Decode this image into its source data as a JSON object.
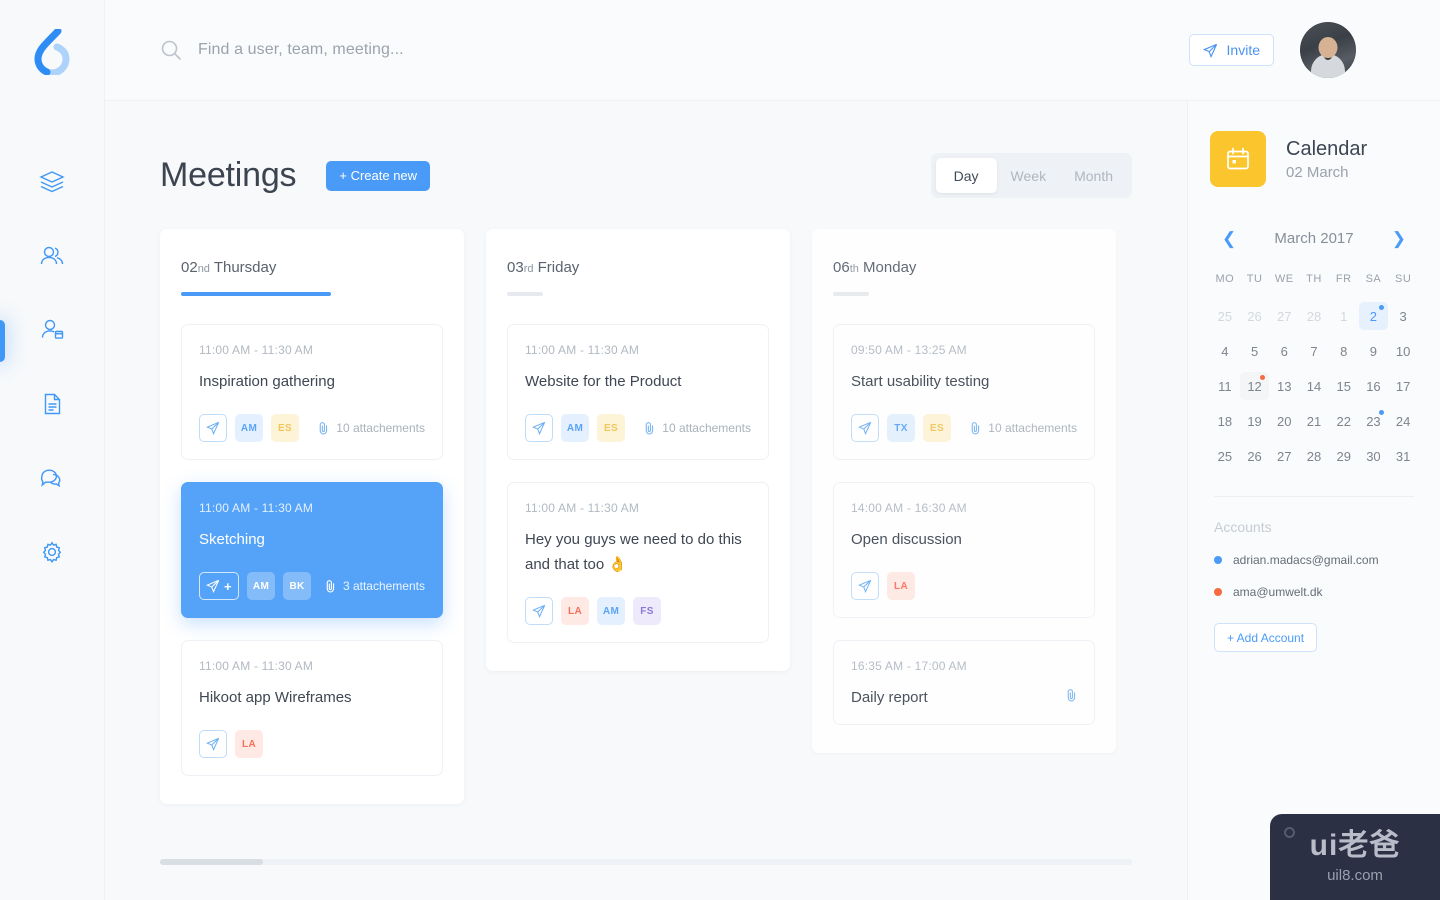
{
  "app": {
    "logo_icon": "droplet-logo"
  },
  "sidebar": {
    "items": [
      {
        "name": "layers",
        "icon": "layers-icon"
      },
      {
        "name": "teams",
        "icon": "users-icon"
      },
      {
        "name": "meetings",
        "icon": "user-calendar-icon",
        "active": true
      },
      {
        "name": "documents",
        "icon": "document-icon"
      },
      {
        "name": "messages",
        "icon": "chat-icon"
      },
      {
        "name": "settings",
        "icon": "gear-icon"
      }
    ]
  },
  "header": {
    "search": {
      "placeholder": "Find a user, team, meeting...",
      "value": "",
      "icon": "search-icon"
    },
    "invite": {
      "label": "Invite",
      "icon": "send-icon"
    },
    "avatar": "user-avatar"
  },
  "main": {
    "title": "Meetings",
    "create_button": "+ Create new",
    "views": [
      {
        "label": "Day",
        "active": true
      },
      {
        "label": "Week",
        "active": false
      },
      {
        "label": "Month",
        "active": false
      }
    ],
    "columns": [
      {
        "day_number": "02",
        "day_suffix": "nd",
        "day_name": "Thursday",
        "progress": "blue",
        "cards": [
          {
            "time": "11:00 AM - 11:30 AM",
            "title": "Inspiration gathering",
            "avatars": [
              {
                "initials": "AM",
                "color": "blue"
              },
              {
                "initials": "ES",
                "color": "yellow"
              }
            ],
            "attachments": "10 attachements",
            "active": false
          },
          {
            "time": "11:00 AM - 11:30 AM",
            "title": "Sketching",
            "avatars": [
              {
                "initials": "AM",
                "color": "white"
              },
              {
                "initials": "BK",
                "color": "white"
              }
            ],
            "attachments": "3 attachements",
            "active": true
          },
          {
            "time": "11:00 AM - 11:30 AM",
            "title": "Hikoot app Wireframes",
            "avatars": [
              {
                "initials": "LA",
                "color": "red"
              }
            ],
            "attachments": "",
            "active": false
          }
        ]
      },
      {
        "day_number": "03",
        "day_suffix": "rd",
        "day_name": "Friday",
        "progress": "grey",
        "cards": [
          {
            "time": "11:00 AM - 11:30 AM",
            "title": "Website for the Product",
            "avatars": [
              {
                "initials": "AM",
                "color": "blue"
              },
              {
                "initials": "ES",
                "color": "yellow"
              }
            ],
            "attachments": "10 attachements",
            "active": false
          },
          {
            "time": "11:00 AM - 11:30 AM",
            "title": "Hey you guys we need to do this and that too 👌",
            "avatars": [
              {
                "initials": "LA",
                "color": "red"
              },
              {
                "initials": "AM",
                "color": "blue"
              },
              {
                "initials": "FS",
                "color": "purple"
              }
            ],
            "attachments": "",
            "active": false
          }
        ]
      },
      {
        "day_number": "06",
        "day_suffix": "th",
        "day_name": "Monday",
        "progress": "grey",
        "cards": [
          {
            "time": "09:50 AM - 13:25 AM",
            "title": "Start usability testing",
            "avatars": [
              {
                "initials": "TX",
                "color": "blue"
              },
              {
                "initials": "ES",
                "color": "yellow"
              }
            ],
            "attachments": "10 attachements",
            "active": false
          },
          {
            "time": "14:00 AM - 16:30 AM",
            "title": "Open discussion",
            "avatars": [
              {
                "initials": "LA",
                "color": "red"
              }
            ],
            "attachments": "",
            "active": false
          },
          {
            "time": "16:35 AM - 17:00 AM",
            "title": "Daily report",
            "avatars": [],
            "attachments": "",
            "attachment_icon_only": true,
            "active": false
          }
        ]
      }
    ]
  },
  "calendar": {
    "icon": "calendar-icon",
    "title": "Calendar",
    "subtitle": "02 March",
    "month_label": "March 2017",
    "prev_icon": "chevron-left-icon",
    "next_icon": "chevron-right-icon",
    "weekdays": [
      "MO",
      "TU",
      "WE",
      "TH",
      "FR",
      "SA",
      "SU"
    ],
    "days": [
      {
        "n": "25",
        "muted": true
      },
      {
        "n": "26",
        "muted": true
      },
      {
        "n": "27",
        "muted": true
      },
      {
        "n": "28",
        "muted": true
      },
      {
        "n": "1",
        "muted": true
      },
      {
        "n": "2",
        "selected": true,
        "dot": "blue"
      },
      {
        "n": "3"
      },
      {
        "n": "4"
      },
      {
        "n": "5"
      },
      {
        "n": "6"
      },
      {
        "n": "7"
      },
      {
        "n": "8"
      },
      {
        "n": "9"
      },
      {
        "n": "10"
      },
      {
        "n": "11"
      },
      {
        "n": "12",
        "soft": true,
        "dot": "orange"
      },
      {
        "n": "13"
      },
      {
        "n": "14"
      },
      {
        "n": "15"
      },
      {
        "n": "16"
      },
      {
        "n": "17"
      },
      {
        "n": "18"
      },
      {
        "n": "19"
      },
      {
        "n": "20"
      },
      {
        "n": "21"
      },
      {
        "n": "22"
      },
      {
        "n": "23",
        "dot": "blue"
      },
      {
        "n": "24"
      },
      {
        "n": "25"
      },
      {
        "n": "26"
      },
      {
        "n": "27"
      },
      {
        "n": "28"
      },
      {
        "n": "29"
      },
      {
        "n": "30"
      },
      {
        "n": "31"
      }
    ]
  },
  "accounts": {
    "label": "Accounts",
    "items": [
      {
        "email": "adrian.madacs@gmail.com",
        "color": "#4a9bf7"
      },
      {
        "email": "ama@umwelt.dk",
        "color": "#f7693f"
      }
    ],
    "add_label": "+ Add Account"
  },
  "watermark": {
    "main": "ui老爸",
    "sub": "uil8.com"
  },
  "colors": {
    "accent": "#4a9bf7",
    "active_card": "#55a3f8",
    "calendar_tile": "#fbc52d",
    "orange": "#f7693f",
    "background": "#f7f9fb"
  }
}
